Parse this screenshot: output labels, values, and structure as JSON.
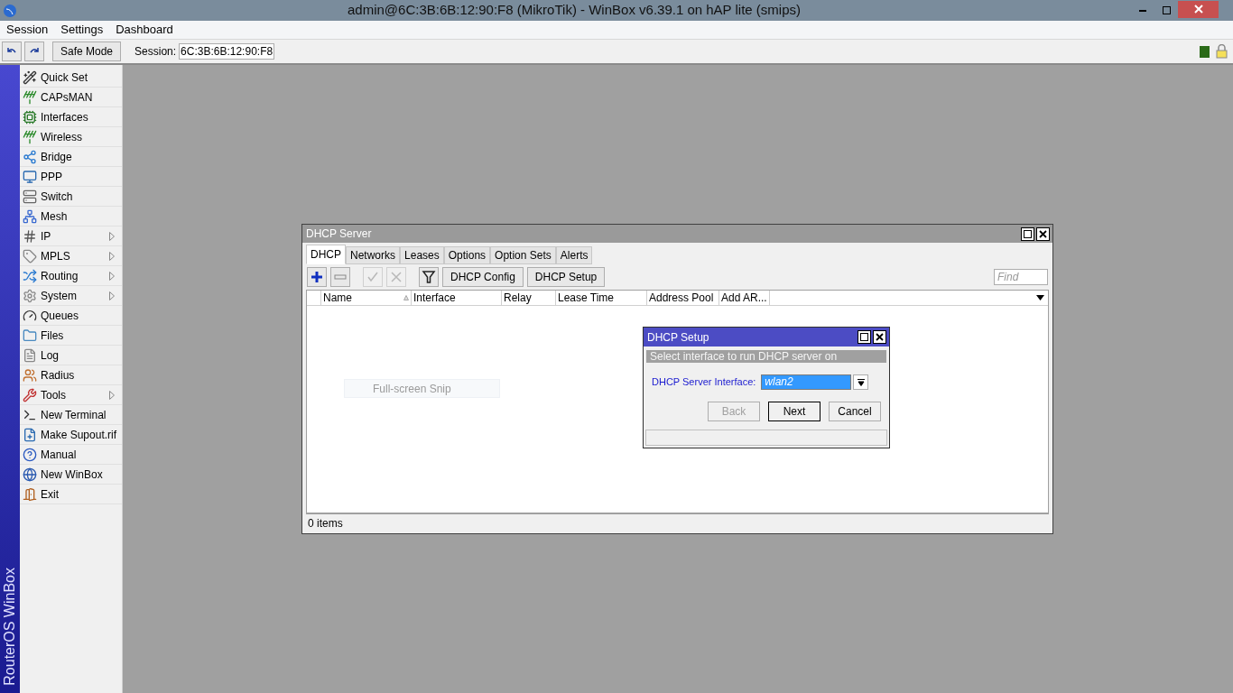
{
  "window": {
    "title": "admin@6C:3B:6B:12:90:F8 (MikroTik) - WinBox v6.39.1 on hAP lite (smips)"
  },
  "menubar": [
    "Session",
    "Settings",
    "Dashboard"
  ],
  "toolbar": {
    "safe_mode": "Safe Mode",
    "session_label": "Session:",
    "session_value": "6C:3B:6B:12:90:F8"
  },
  "sidebar": {
    "brand": "RouterOS WinBox",
    "items": [
      {
        "label": "Quick Set",
        "submenu": false
      },
      {
        "label": "CAPsMAN",
        "submenu": false
      },
      {
        "label": "Interfaces",
        "submenu": false
      },
      {
        "label": "Wireless",
        "submenu": false
      },
      {
        "label": "Bridge",
        "submenu": false
      },
      {
        "label": "PPP",
        "submenu": false
      },
      {
        "label": "Switch",
        "submenu": false
      },
      {
        "label": "Mesh",
        "submenu": false
      },
      {
        "label": "IP",
        "submenu": true
      },
      {
        "label": "MPLS",
        "submenu": true
      },
      {
        "label": "Routing",
        "submenu": true
      },
      {
        "label": "System",
        "submenu": true
      },
      {
        "label": "Queues",
        "submenu": false
      },
      {
        "label": "Files",
        "submenu": false
      },
      {
        "label": "Log",
        "submenu": false
      },
      {
        "label": "Radius",
        "submenu": false
      },
      {
        "label": "Tools",
        "submenu": true
      },
      {
        "label": "New Terminal",
        "submenu": false
      },
      {
        "label": "Make Supout.rif",
        "submenu": false
      },
      {
        "label": "Manual",
        "submenu": false
      },
      {
        "label": "New WinBox",
        "submenu": false
      },
      {
        "label": "Exit",
        "submenu": false
      }
    ]
  },
  "dhcp_window": {
    "title": "DHCP Server",
    "tabs": [
      {
        "label": "DHCP",
        "selected": true
      },
      {
        "label": "Networks",
        "selected": false
      },
      {
        "label": "Leases",
        "selected": false
      },
      {
        "label": "Options",
        "selected": false
      },
      {
        "label": "Option Sets",
        "selected": false
      },
      {
        "label": "Alerts",
        "selected": false
      }
    ],
    "tool_icons": [
      {
        "kind": "add",
        "disabled": false
      },
      {
        "kind": "remove",
        "disabled": false
      },
      {
        "kind": "enable",
        "disabled": true
      },
      {
        "kind": "disable",
        "disabled": true
      },
      {
        "kind": "filter",
        "disabled": false
      }
    ],
    "buttons": [
      "DHCP Config",
      "DHCP Setup"
    ],
    "find": {
      "placeholder": "Find"
    },
    "columns": [
      {
        "label": "Name",
        "sorted": true
      },
      {
        "label": "Interface",
        "sorted": false
      },
      {
        "label": "Relay",
        "sorted": false
      },
      {
        "label": "Lease Time",
        "sorted": false
      },
      {
        "label": "Address Pool",
        "sorted": false
      },
      {
        "label": "Add AR...",
        "sorted": false
      }
    ],
    "status": "0 items"
  },
  "snip_overlay": "Full-screen Snip",
  "setup_dialog": {
    "title": "DHCP Setup",
    "instruction": "Select interface to run DHCP server on",
    "field_label": "DHCP Server Interface:",
    "field_value": "wlan2",
    "buttons": [
      {
        "label": "Back",
        "disabled": true,
        "default": false
      },
      {
        "label": "Next",
        "disabled": false,
        "default": true
      },
      {
        "label": "Cancel",
        "disabled": false,
        "default": false
      }
    ]
  }
}
